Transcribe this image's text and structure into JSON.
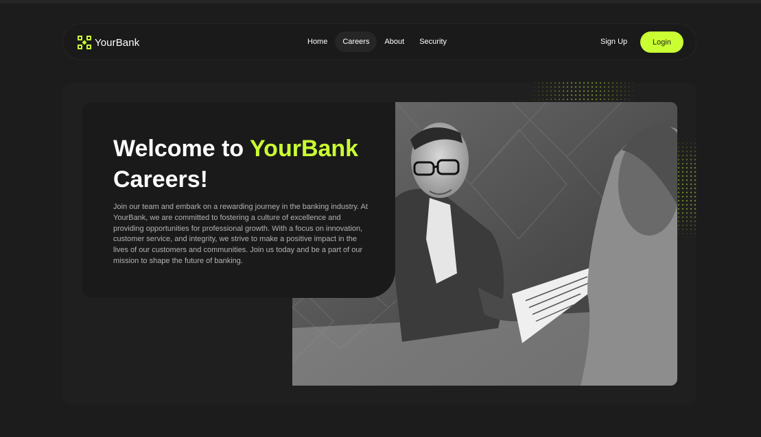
{
  "brand": {
    "name": "YourBank",
    "accent_color": "#caff33"
  },
  "nav": {
    "items": [
      {
        "label": "Home",
        "active": false
      },
      {
        "label": "Careers",
        "active": true
      },
      {
        "label": "About",
        "active": false
      },
      {
        "label": "Security",
        "active": false
      }
    ],
    "signup_label": "Sign Up",
    "login_label": "Login"
  },
  "hero": {
    "title_prefix": "Welcome to ",
    "title_highlight": "YourBank",
    "title_suffix": "Careers!",
    "description": "Join our team and embark on a rewarding journey in the banking industry. At YourBank, we are committed to fostering a culture of excellence and providing opportunities for professional growth. With a focus on innovation, customer service, and integrity, we strive to make a positive impact in the lives of our customers and communities. Join us today and be a part of our mission to shape the future of banking.",
    "image_subject": "team-meeting-photo"
  }
}
